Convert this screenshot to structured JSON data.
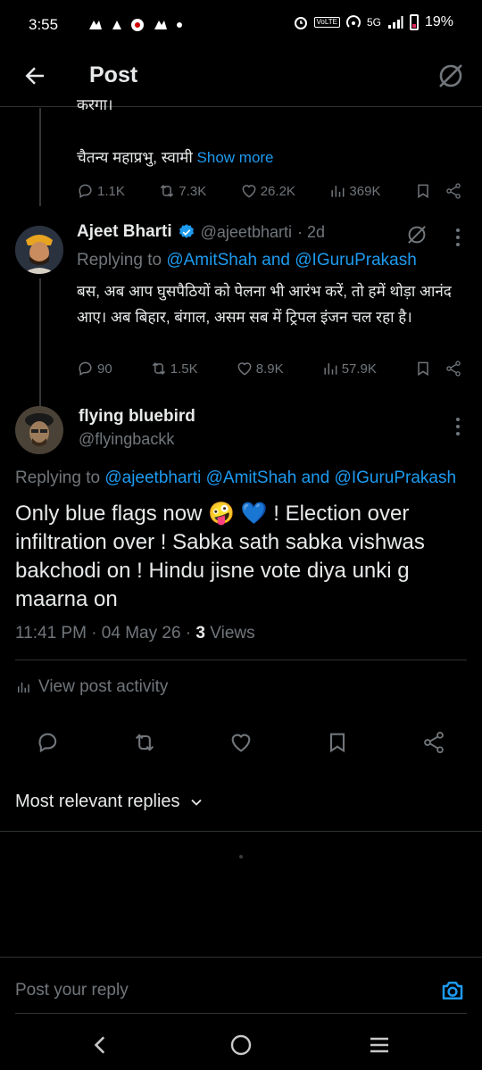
{
  "status_bar": {
    "time": "3:55",
    "network": "5G",
    "volte": "VoLTE",
    "battery": "19%"
  },
  "header": {
    "title": "Post"
  },
  "parent_post_tail": {
    "cut_text": "करेगा।",
    "text": "चैतन्य महाप्रभु, स्वामी",
    "show_more": "Show more",
    "stats": {
      "replies": "1.1K",
      "reposts": "7.3K",
      "likes": "26.2K",
      "views": "369K"
    }
  },
  "reply_post": {
    "name": "Ajeet Bharti",
    "handle": "@ajeetbharti",
    "time": "· 2d",
    "replying_label": "Replying to",
    "replying_to": "@AmitShah and @IGuruPrakash",
    "text": "बस, अब आप घुसपैठियों को पेलना भी आरंभ करें, तो हमें थोड़ा आनंद आए। अब बिहार, बंगाल, असम सब में ट्रिपल इंजन चल रहा है।",
    "stats": {
      "replies": "90",
      "reposts": "1.5K",
      "likes": "8.9K",
      "views": "57.9K"
    }
  },
  "main_post": {
    "name": "flying bluebird",
    "handle": "@flyingbackk",
    "replying_label": "Replying to",
    "replying_to": "@ajeetbharti @AmitShah and @IGuruPrakash",
    "text_part1": "Only blue flags now ",
    "emoji1": "🤪",
    "emoji2": "💙",
    "text_part2": " ! Election over infiltration over ! Sabka sath sabka vishwas bakchodi on ! Hindu jisne vote diya unki g maarna on",
    "timestamp": "11:41 PM · 04 May 26 · ",
    "views_count": "3",
    "views_label": " Views",
    "activity": "View post activity"
  },
  "replies_sort": {
    "label": "Most relevant replies"
  },
  "reply_bar": {
    "placeholder": "Post your reply"
  },
  "colors": {
    "accent": "#1d9bf0",
    "background": "#000000",
    "muted": "#71767b",
    "divider": "#2f3336"
  }
}
